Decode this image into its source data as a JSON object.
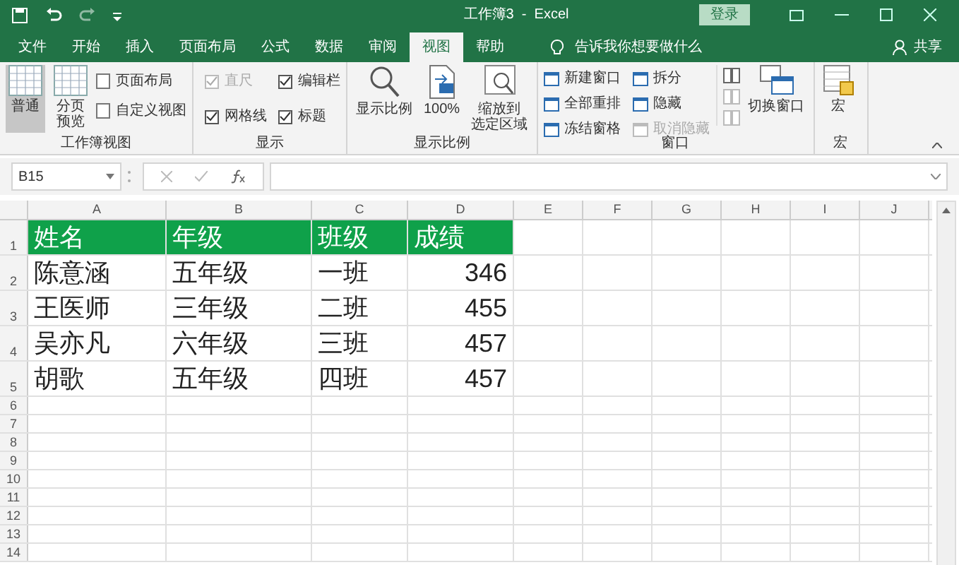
{
  "window": {
    "title": "工作簿3  -  Excel",
    "sign_in": "登录"
  },
  "tabs": [
    {
      "label": "文件",
      "selected": false
    },
    {
      "label": "开始",
      "selected": false
    },
    {
      "label": "插入",
      "selected": false
    },
    {
      "label": "页面布局",
      "selected": false
    },
    {
      "label": "公式",
      "selected": false
    },
    {
      "label": "数据",
      "selected": false
    },
    {
      "label": "审阅",
      "selected": false
    },
    {
      "label": "视图",
      "selected": true
    },
    {
      "label": "帮助",
      "selected": false
    }
  ],
  "tell_me": "告诉我你想要做什么",
  "share": "共享",
  "ribbon": {
    "workbook_views": {
      "label": "工作簿视图",
      "normal": {
        "label": "普通",
        "selected": true
      },
      "page_break": {
        "label": "分页预览",
        "selected": false
      },
      "page_layout": "页面布局",
      "custom_views": "自定义视图"
    },
    "show": {
      "label": "显示",
      "options": [
        {
          "label": "直尺",
          "checked": true,
          "disabled": true
        },
        {
          "label": "编辑栏",
          "checked": true,
          "disabled": false
        },
        {
          "label": "网格线",
          "checked": true,
          "disabled": false
        },
        {
          "label": "标题",
          "checked": true,
          "disabled": false
        }
      ]
    },
    "zoom": {
      "label": "显示比例",
      "buttons": [
        {
          "lines": [
            "显示比例"
          ]
        },
        {
          "lines": [
            "100%"
          ]
        },
        {
          "lines": [
            "缩放到",
            "选定区域"
          ]
        }
      ]
    },
    "window": {
      "label": "窗口",
      "items": [
        {
          "label": "新建窗口",
          "disabled": false
        },
        {
          "label": "全部重排",
          "disabled": false
        },
        {
          "label": "冻结窗格",
          "disabled": false
        },
        {
          "label": "拆分",
          "disabled": false
        },
        {
          "label": "隐藏",
          "disabled": false
        },
        {
          "label": "取消隐藏",
          "disabled": true
        }
      ],
      "switch": "切换窗口"
    },
    "macros": {
      "label": "宏",
      "button": "宏"
    }
  },
  "name_box": "B15",
  "columns": [
    "A",
    "B",
    "C",
    "D",
    "E",
    "F",
    "G",
    "H",
    "I",
    "J"
  ],
  "rows": [
    {
      "number": "1",
      "cells": [
        "姓名",
        "年级",
        "班级",
        "成绩"
      ],
      "kind": "header"
    },
    {
      "number": "2",
      "cells": [
        "陈意涵",
        "五年级",
        "一班",
        "346"
      ],
      "kind": "data"
    },
    {
      "number": "3",
      "cells": [
        "王医师",
        "三年级",
        "二班",
        "455"
      ],
      "kind": "data"
    },
    {
      "number": "4",
      "cells": [
        "吴亦凡",
        "六年级",
        "三班",
        "457"
      ],
      "kind": "data"
    },
    {
      "number": "5",
      "cells": [
        "胡歌",
        "五年级",
        "四班",
        "457"
      ],
      "kind": "data"
    },
    {
      "number": "6",
      "kind": "empty"
    },
    {
      "number": "7",
      "kind": "empty"
    },
    {
      "number": "8",
      "kind": "empty"
    },
    {
      "number": "9",
      "kind": "empty"
    },
    {
      "number": "10",
      "kind": "empty"
    },
    {
      "number": "11",
      "kind": "empty"
    },
    {
      "number": "12",
      "kind": "empty"
    },
    {
      "number": "13",
      "kind": "empty"
    },
    {
      "number": "14",
      "kind": "empty"
    }
  ]
}
